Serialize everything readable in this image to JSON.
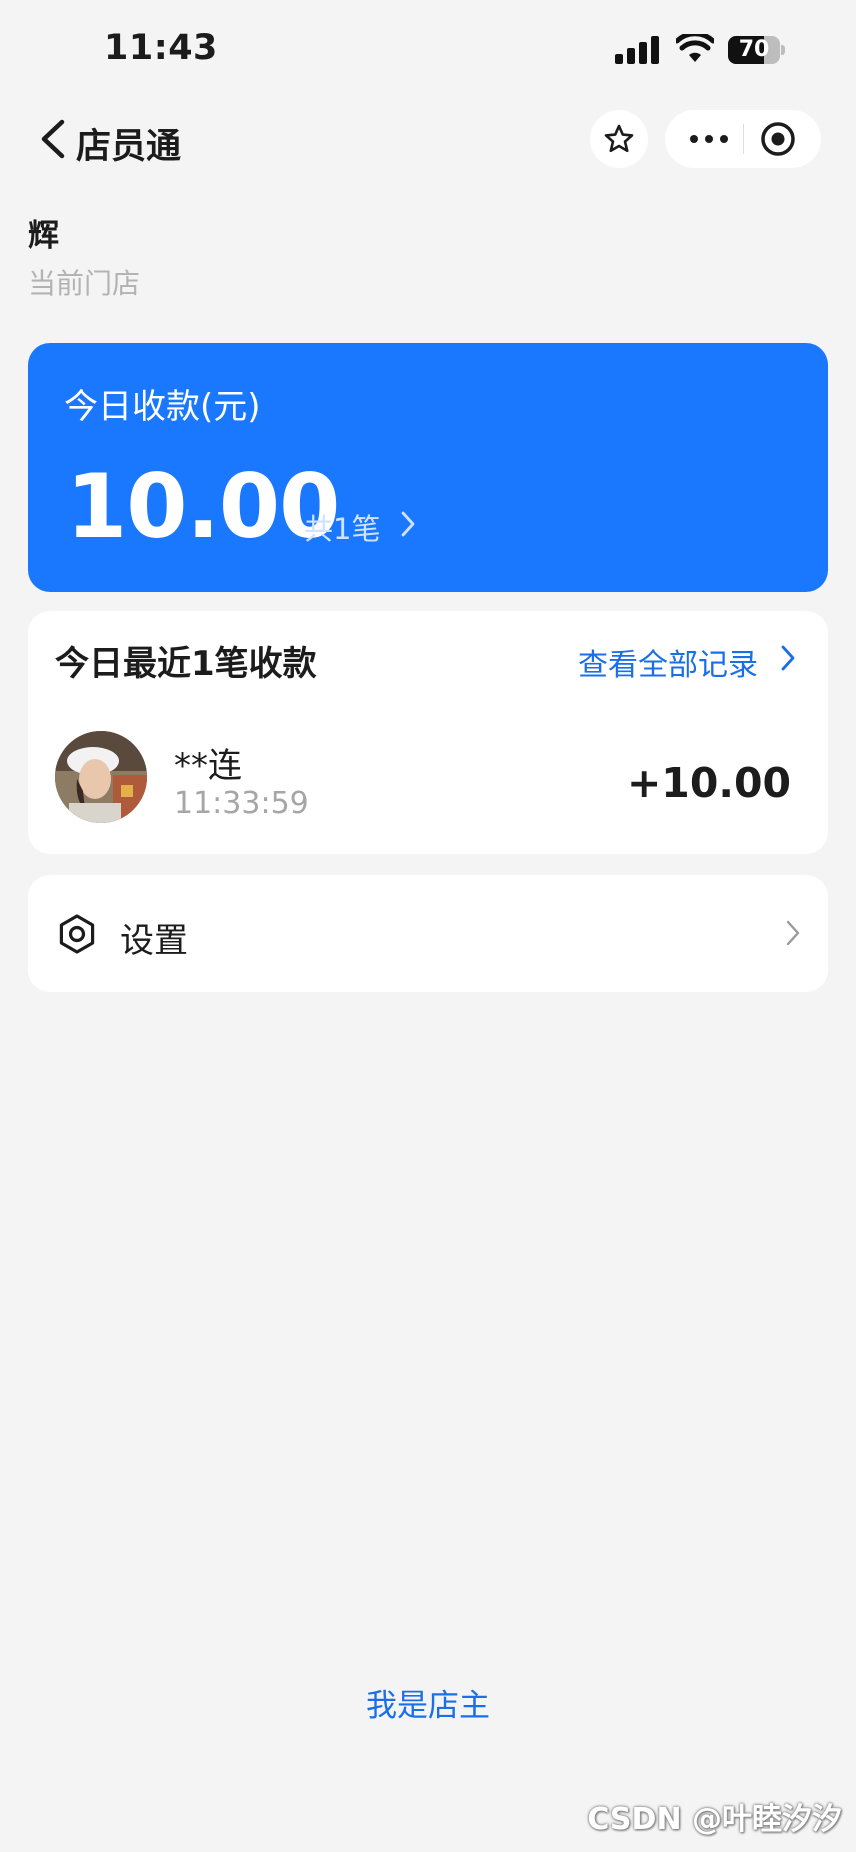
{
  "status_bar": {
    "time": "11:43",
    "battery": "70",
    "battery_level": 0.7
  },
  "nav": {
    "title": "店员通",
    "icons": [
      "back-arrow-icon",
      "star-icon",
      "more-dots-icon",
      "close-circle-icon"
    ]
  },
  "store": {
    "name": "辉",
    "subtitle": "当前门店"
  },
  "income": {
    "label": "今日收款(元)",
    "amount": "10.00",
    "count": "共1笔"
  },
  "recent": {
    "title": "今日最近1笔收款",
    "view_all": "查看全部记录",
    "transactions": [
      {
        "name": "**连",
        "time": "11:33:59",
        "amount": "+10.00"
      }
    ]
  },
  "settings": {
    "label": "设置"
  },
  "footer": {
    "owner_link": "我是店主"
  },
  "watermark": "CSDN @叶睦汐汐",
  "colors": {
    "primary": "#1a78ff",
    "link": "#1a6fe8",
    "background": "#f4f4f4"
  }
}
